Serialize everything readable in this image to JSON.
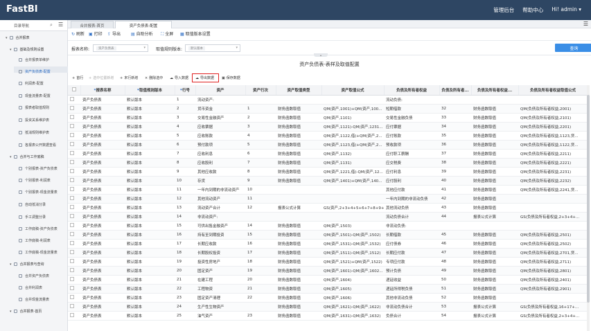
{
  "app": {
    "logo": "FastBI",
    "links": [
      "管理后台",
      "帮助中心",
      "Hi! admin ▾"
    ]
  },
  "sidebar": {
    "title": "目录导航",
    "groups": [
      {
        "label": "合并报表",
        "level": 1
      },
      {
        "label": "基础及规则设置",
        "level": 2
      },
      {
        "label": "合并报表单维护",
        "level": 3
      },
      {
        "label": "资产负债表-配置",
        "level": 3,
        "active": true
      },
      {
        "label": "利润表-配置",
        "level": 3
      },
      {
        "label": "现金流量表-配置",
        "level": 3
      },
      {
        "label": "报表者取值规则",
        "level": 3
      },
      {
        "label": "投资关系维护表",
        "level": 3
      },
      {
        "label": "抵消规则维护表",
        "level": 3
      },
      {
        "label": "各报表公开数据查看",
        "level": 3
      },
      {
        "label": "合并与工作底稿",
        "level": 2
      },
      {
        "label": "个别报表-资产负债表",
        "level": 3
      },
      {
        "label": "个别报表-利润表",
        "level": 3
      },
      {
        "label": "个别报表-现金流量表",
        "level": 3
      },
      {
        "label": "自动抵消分录",
        "level": 3
      },
      {
        "label": "手工调整分录",
        "level": 3
      },
      {
        "label": "工作底稿-资产负债表",
        "level": 3
      },
      {
        "label": "工作底稿-利润表",
        "level": 3
      },
      {
        "label": "工作底稿-现金流量表",
        "level": 3
      },
      {
        "label": "合并报表与查询",
        "level": 2
      },
      {
        "label": "合并资产负债表",
        "level": 3
      },
      {
        "label": "合并利润表",
        "level": 3
      },
      {
        "label": "合并现金流量表",
        "level": 3
      },
      {
        "label": "合并报表-首页",
        "level": 2
      }
    ]
  },
  "tabs": [
    "合并报表-首页",
    "资产负债表-配置"
  ],
  "toolbar": [
    "刷新",
    "打印",
    "导出",
    "自助分析",
    "全屏",
    "取值版本设置"
  ],
  "search": {
    "name_label": "报表名称:",
    "name_value": "资产负债表",
    "version_label": "取值规则版本:",
    "version_value": "默认版本",
    "query": "查询"
  },
  "panel_title": "资产负债表-表样及取值配置",
  "actions": [
    "首行",
    "选中位置新增",
    "末行新增",
    "删除选中",
    "导入数据",
    "导出数据",
    "保存数据"
  ],
  "table": {
    "headers": [
      "",
      "报表名称",
      "取值规则版本",
      "行号",
      "资产",
      "资产行次",
      "资产取值类型",
      "资产取值公式",
      "负债及所有者权益",
      "负债及所有者...",
      "负债及所有者权益...",
      "负债及所有者权益取值公式"
    ],
    "rows": [
      [
        "资产负债表",
        "默认版本",
        "1",
        "流动资产:",
        "",
        "",
        "",
        "流动负债:",
        "",
        "",
        ""
      ],
      [
        "资产负债表",
        "默认版本",
        "2",
        "货币资金",
        "1",
        "财务函数取值",
        "QM(资产,1001)+QM(资产,100...",
        "短期借款",
        "32",
        "财务函数取值",
        "QM(负债及所有者权益,2001)"
      ],
      [
        "资产负债表",
        "默认版本",
        "3",
        "交易性金融资产",
        "2",
        "财务函数取值",
        "QM(资产,1101)",
        "交易性金融负债",
        "33",
        "财务函数取值",
        "QM(负债及所有者权益,2101)"
      ],
      [
        "资产负债表",
        "默认版本",
        "4",
        "应收票据",
        "3",
        "财务函数取值",
        "QM(资产,1121)-QM(资产,1231...",
        "应付票据",
        "34",
        "财务函数取值",
        "QM(负债及所有者权益,2201)"
      ],
      [
        "资产负债表",
        "默认版本",
        "5",
        "应收账款",
        "4",
        "财务函数取值",
        "QM(资产,1122,借)+QM(资产,2...",
        "应付账款",
        "35",
        "财务函数取值",
        "QM(负债及所有者权益,1123,贷..."
      ],
      [
        "资产负债表",
        "默认版本",
        "6",
        "预付款项",
        "5",
        "财务函数取值",
        "QM(资产,1123,借)+QM(资产,2...",
        "预收款项",
        "36",
        "财务函数取值",
        "QM(负债及所有者权益,1122,贷..."
      ],
      [
        "资产负债表",
        "默认版本",
        "7",
        "应收利息",
        "6",
        "财务函数取值",
        "QM(资产,1132)",
        "应付职工薪酬",
        "37",
        "财务函数取值",
        "QM(负债及所有者权益,2211)"
      ],
      [
        "资产负债表",
        "默认版本",
        "8",
        "应收股利",
        "7",
        "财务函数取值",
        "QM(资产,1131)",
        "应交税费",
        "38",
        "财务函数取值",
        "QM(负债及所有者权益,2221)"
      ],
      [
        "资产负债表",
        "默认版本",
        "9",
        "其他应收款",
        "8",
        "财务函数取值",
        "QM(资产,1221,借)-QM(资产,12...",
        "应付利息",
        "39",
        "财务函数取值",
        "QM(负债及所有者权益,2231)"
      ],
      [
        "资产负债表",
        "默认版本",
        "10",
        "存货",
        "9",
        "财务函数取值",
        "QM(资产,1401)+QM(资产,140...",
        "应付股利",
        "40",
        "财务函数取值",
        "QM(负债及所有者权益,2232)"
      ],
      [
        "资产负债表",
        "默认版本",
        "11",
        "一年内到期的非流动资产",
        "10",
        "",
        "",
        "其他应付款",
        "41",
        "财务函数取值",
        "QM(负债及所有者权益,2241,贷..."
      ],
      [
        "资产负债表",
        "默认版本",
        "12",
        "其他流动资产",
        "11",
        "",
        "",
        "一年内到期的非流动负债",
        "42",
        "财务函数取值",
        ""
      ],
      [
        "资产负债表",
        "默认版本",
        "13",
        "流动资产合计",
        "12",
        "报表公式计算",
        "GS(资产,2+3+4+5+6+7+8+9+...",
        "其他流动负债",
        "43",
        "财务函数取值",
        ""
      ],
      [
        "资产负债表",
        "默认版本",
        "14",
        "非流动资产:",
        "",
        "",
        "",
        "流动负债合计",
        "44",
        "报表公式计算",
        "GS(负债及所有者权益,2+3+4+..."
      ],
      [
        "资产负债表",
        "默认版本",
        "15",
        "可供出售金融资产",
        "14",
        "财务函数取值",
        "QM(资产,1503)",
        "非流动负债:",
        "",
        "",
        ""
      ],
      [
        "资产负债表",
        "默认版本",
        "16",
        "持有至到期投资",
        "15",
        "财务函数取值",
        "QM(资产,1501)-QM(资产,1502)",
        "长期借款",
        "45",
        "财务函数取值",
        "QM(负债及所有者权益,2501)"
      ],
      [
        "资产负债表",
        "默认版本",
        "17",
        "长期应收款",
        "16",
        "财务函数取值",
        "QM(资产,1531)-QM(资产,1532)",
        "应付债券",
        "46",
        "财务函数取值",
        "QM(负债及所有者权益,2502)"
      ],
      [
        "资产负债表",
        "默认版本",
        "18",
        "长期股权投资",
        "17",
        "财务函数取值",
        "QM(资产,1511)-QM(资产,1512)",
        "长期应付款",
        "47",
        "财务函数取值",
        "QM(负债及所有者权益,2701,贷..."
      ],
      [
        "资产负债表",
        "默认版本",
        "19",
        "投资性房地产",
        "18",
        "财务函数取值",
        "QM(资产,1521)+QM(资产,1522)",
        "专项应付款",
        "48",
        "财务函数取值",
        "QM(负债及所有者权益,2711)"
      ],
      [
        "资产负债表",
        "默认版本",
        "20",
        "固定资产",
        "19",
        "财务函数取值",
        "QM(资产,1601)-QM(资产,1602...",
        "预计负债",
        "49",
        "财务函数取值",
        "QM(负债及所有者权益,2801)"
      ],
      [
        "资产负债表",
        "默认版本",
        "21",
        "在建工程",
        "20",
        "财务函数取值",
        "QM(资产,1604)",
        "递延收益",
        "50",
        "财务函数取值",
        "QM(负债及所有者权益,2401)"
      ],
      [
        "资产负债表",
        "默认版本",
        "22",
        "工程物资",
        "21",
        "财务函数取值",
        "QM(资产,1605)",
        "递延所得税负债",
        "51",
        "财务函数取值",
        "QM(负债及所有者权益,2901)"
      ],
      [
        "资产负债表",
        "默认版本",
        "23",
        "固定资产清理",
        "22",
        "财务函数取值",
        "QM(资产,1606)",
        "其他非流动负债",
        "52",
        "财务函数取值",
        ""
      ],
      [
        "资产负债表",
        "默认版本",
        "24",
        "生产性生物资产",
        "",
        "财务函数取值",
        "QM(资产,1621)-QM(资产,1622)",
        "非流动负债合计",
        "53",
        "报表公式计算",
        "GS(负债及所有者权益,16+17+..."
      ],
      [
        "资产负债表",
        "默认版本",
        "25",
        "油气资产",
        "23",
        "财务函数取值",
        "QM(资产,1631)-QM(资产,1632)",
        "负债合计",
        "54",
        "报表公式计算",
        "GS(负债及所有者权益,2+3+4+..."
      ]
    ]
  }
}
